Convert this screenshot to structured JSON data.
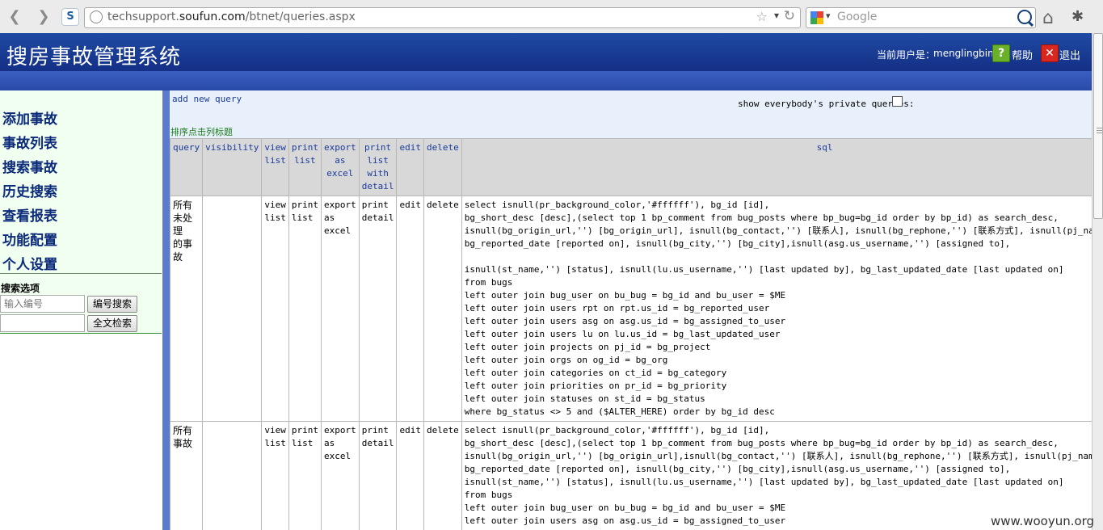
{
  "browser": {
    "url_prefix": "techsupport.",
    "url_domain": "soufun.com",
    "url_path": "/btnet/queries.aspx",
    "search_placeholder": "Google",
    "site_icon_letter": "S"
  },
  "header": {
    "title": "搜房事故管理系统",
    "user_label": "当前用户是：",
    "user_name": "menglingbin",
    "help_label": "帮助",
    "exit_label": "退出"
  },
  "sidebar": {
    "menu": [
      "添加事故",
      "事故列表",
      "搜索事故",
      "历史搜索",
      "查看报表",
      "功能配置",
      "个人设置"
    ],
    "search_title": "搜索选项",
    "id_placeholder": "输入编号",
    "id_search_button": "编号搜索",
    "fulltext_button": "全文检索"
  },
  "main": {
    "add_query": "add new query",
    "private_label": "show everybody's private queries:",
    "sort_hint": "排序点击列标题",
    "columns": {
      "query": "query",
      "visibility": "visibility",
      "view_list": [
        "view",
        "list"
      ],
      "print_list": [
        "print",
        "list"
      ],
      "export_excel": [
        "export as",
        "excel"
      ],
      "print_detail": [
        "print",
        "list",
        "with",
        "detail"
      ],
      "edit": "edit",
      "delete": "delete",
      "sql": "sql"
    },
    "rows": [
      {
        "query": [
          "所有未处理",
          "的事故"
        ],
        "visibility": "",
        "view": [
          "view",
          "list"
        ],
        "print": [
          "print",
          "list"
        ],
        "export": [
          "export as",
          "excel"
        ],
        "print_detail": [
          "print",
          "detail"
        ],
        "edit": "edit",
        "delete": "delete",
        "sql": [
          "select isnull(pr_background_color,'#ffffff'), bg_id [id],",
          "bg_short_desc [desc],(select top 1 bp_comment from bug_posts where bp_bug=bg_id order by bp_id) as search_desc,",
          "isnull(bg_origin_url,'') [bg_origin_url], isnull(bg_contact,'') [联系人], isnull(bg_rephone,'') [联系方式], isnull(pj_name,'') [project],",
          "bg_reported_date [reported on], isnull(bg_city,'') [bg_city],isnull(asg.us_username,'') [assigned to],",
          "",
          "isnull(st_name,'') [status], isnull(lu.us_username,'') [last updated by], bg_last_updated_date [last updated on]",
          "from bugs",
          "left outer join bug_user on bu_bug = bg_id and bu_user = $ME",
          "left outer join users rpt on rpt.us_id = bg_reported_user",
          "left outer join users asg on asg.us_id = bg_assigned_to_user",
          "left outer join users lu on lu.us_id = bg_last_updated_user",
          "left outer join projects on pj_id = bg_project",
          "left outer join orgs on og_id = bg_org",
          "left outer join categories on ct_id = bg_category",
          "left outer join priorities on pr_id = bg_priority",
          "left outer join statuses on st_id = bg_status",
          "where bg_status <> 5 and ($ALTER_HERE) order by bg_id desc"
        ]
      },
      {
        "query": [
          "所有事故"
        ],
        "visibility": "",
        "view": [
          "view",
          "list"
        ],
        "print": [
          "print",
          "list"
        ],
        "export": [
          "export as",
          "excel"
        ],
        "print_detail": [
          "print",
          "detail"
        ],
        "edit": "edit",
        "delete": "delete",
        "sql": [
          "select isnull(pr_background_color,'#ffffff'), bg_id [id],",
          "bg_short_desc [desc],(select top 1 bp_comment from bug_posts where bp_bug=bg_id order by bp_id) as search_desc,",
          "isnull(bg_origin_url,'') [bg_origin_url],isnull(bg_contact,'') [联系人], isnull(bg_rephone,'') [联系方式], isnull(pj_name,'') [project],",
          "bg_reported_date [reported on], isnull(bg_city,'') [bg_city],isnull(asg.us_username,'') [assigned to],",
          "isnull(st_name,'') [status], isnull(lu.us_username,'') [last updated by], bg_last_updated_date [last updated on]",
          "from bugs",
          "left outer join bug_user on bu_bug = bg_id and bu_user = $ME",
          "left outer join users asg on asg.us_id = bg_assigned_to_user"
        ]
      }
    ]
  },
  "watermark": "www.wooyun.org"
}
